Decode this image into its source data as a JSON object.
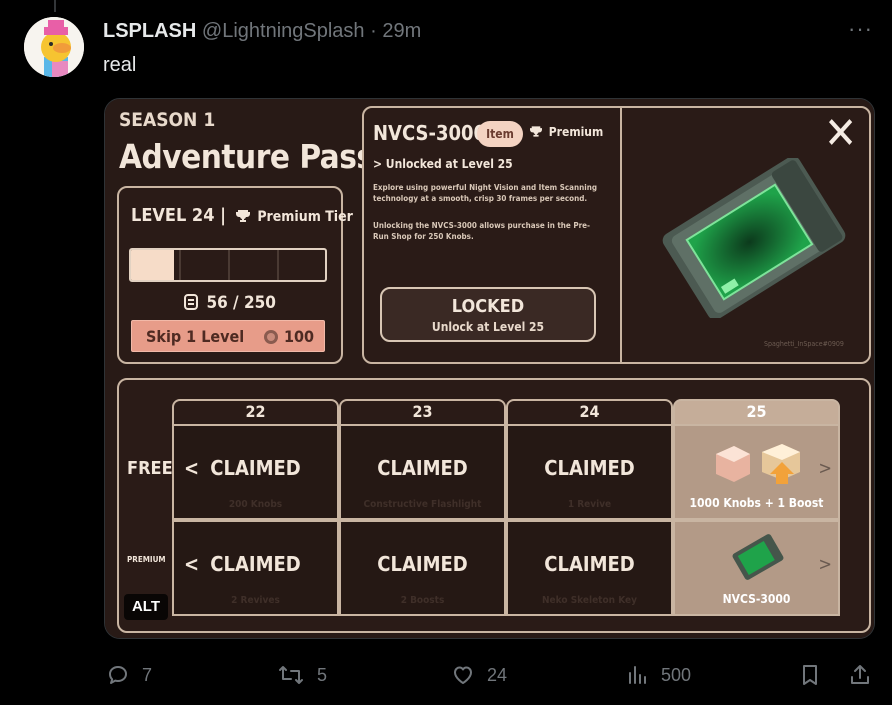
{
  "tweet": {
    "display_name": "LSPLASH",
    "handle": "@LightningSplash",
    "separator": "·",
    "time": "29m",
    "text": "real",
    "more": "···"
  },
  "game": {
    "season": "SEASON 1",
    "pass_title": "Adventure Pass",
    "level": {
      "label": "LEVEL 24 |",
      "tier": "Premium Tier",
      "progress": 0.22,
      "xp": "56 / 250",
      "skip_label": "Skip 1 Level",
      "skip_cost": "100"
    },
    "item": {
      "name": "NVCS-3000",
      "pill": "Item",
      "premium": "Premium",
      "unlock_text": "> Unlocked at Level 25",
      "description": "Explore using powerful Night Vision and Item Scanning technology at a smooth, crisp 30 frames per second.",
      "description2": "Unlocking the NVCS-3000 allows purchase in the Pre-Run Shop for 250 Knobs.",
      "locked_title": "LOCKED",
      "locked_sub": "Unlock at Level 25",
      "close": "✕",
      "watermark": "Spaghetti_InSpace#0909"
    },
    "rewards": {
      "free_label": "FREE",
      "premium_label": "PREMIUM",
      "columns": [
        {
          "level": "22",
          "free": "CLAIMED",
          "free_ghost": "200 Knobs",
          "premium": "CLAIMED",
          "premium_ghost": "2 Revives"
        },
        {
          "level": "23",
          "free": "CLAIMED",
          "free_ghost": "Constructive Flashlight",
          "premium": "CLAIMED",
          "premium_ghost": "2 Boosts"
        },
        {
          "level": "24",
          "free": "CLAIMED",
          "free_ghost": "1 Revive",
          "premium": "CLAIMED",
          "premium_ghost": "Neko Skeleton Key"
        },
        {
          "level": "25",
          "free_reward": "1000 Knobs + 1 Boost",
          "premium_reward": "NVCS-3000"
        }
      ],
      "prev_arrow": "<",
      "next_arrow": ">"
    }
  },
  "alt_badge": "ALT",
  "actions": {
    "replies": "7",
    "reposts": "5",
    "likes": "24",
    "views": "500"
  }
}
